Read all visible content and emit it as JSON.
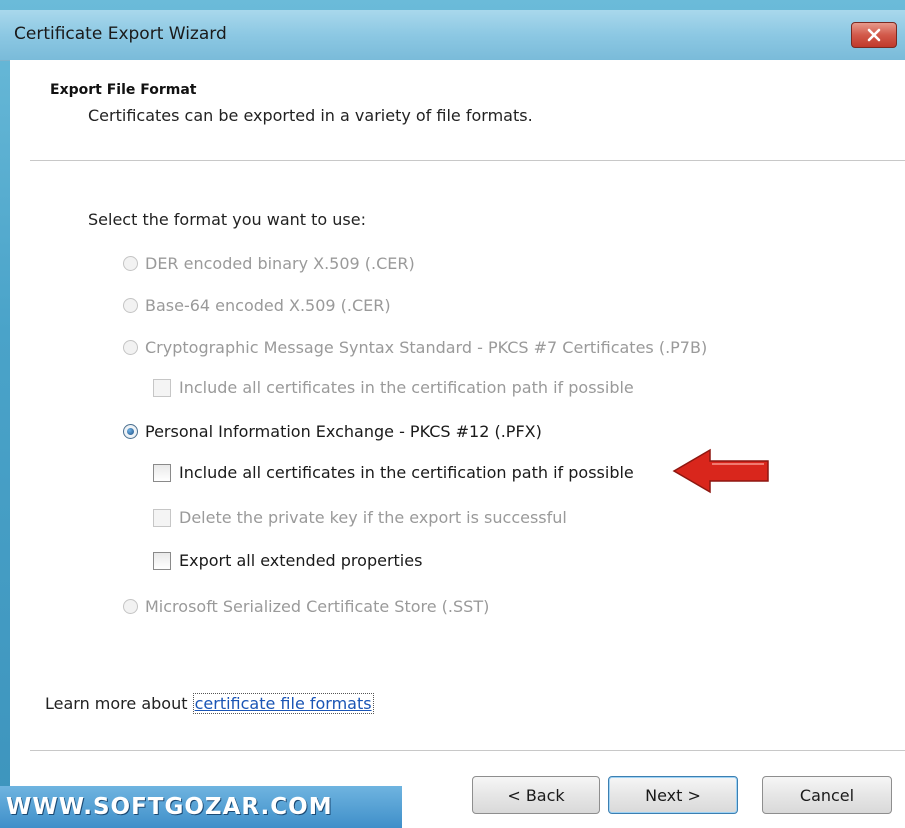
{
  "window": {
    "title": "Certificate Export Wizard",
    "close_icon": "close-icon"
  },
  "header": {
    "title": "Export File Format",
    "subtitle": "Certificates can be exported in a variety of file formats."
  },
  "prompt": "Select the format you want to use:",
  "options": {
    "der": {
      "label": "DER encoded binary X.509 (.CER)",
      "checked": false,
      "enabled": false
    },
    "base64": {
      "label": "Base-64 encoded X.509 (.CER)",
      "checked": false,
      "enabled": false
    },
    "pkcs7": {
      "label": "Cryptographic Message Syntax Standard - PKCS #7 Certificates (.P7B)",
      "checked": false,
      "enabled": false
    },
    "pkcs7_include": {
      "label": "Include all certificates in the certification path if possible",
      "checked": false,
      "enabled": false
    },
    "pfx": {
      "label": "Personal Information Exchange - PKCS #12 (.PFX)",
      "checked": true,
      "enabled": true
    },
    "pfx_include": {
      "label": "Include all certificates in the certification path if possible",
      "checked": false,
      "enabled": true
    },
    "pfx_delete_key": {
      "label": "Delete the private key if the export is successful",
      "checked": false,
      "enabled": false
    },
    "pfx_export_ext": {
      "label": "Export all extended properties",
      "checked": false,
      "enabled": true
    },
    "sst": {
      "label": "Microsoft Serialized Certificate Store (.SST)",
      "checked": false,
      "enabled": false
    }
  },
  "learn_more": {
    "prefix": "Learn more about ",
    "link": "certificate file formats"
  },
  "buttons": {
    "back": "< Back",
    "next": "Next >",
    "cancel": "Cancel"
  },
  "watermark": "WWW.SOFTGOZAR.COM",
  "annotation": {
    "icon": "red-arrow-icon",
    "color": "#d9261c"
  }
}
